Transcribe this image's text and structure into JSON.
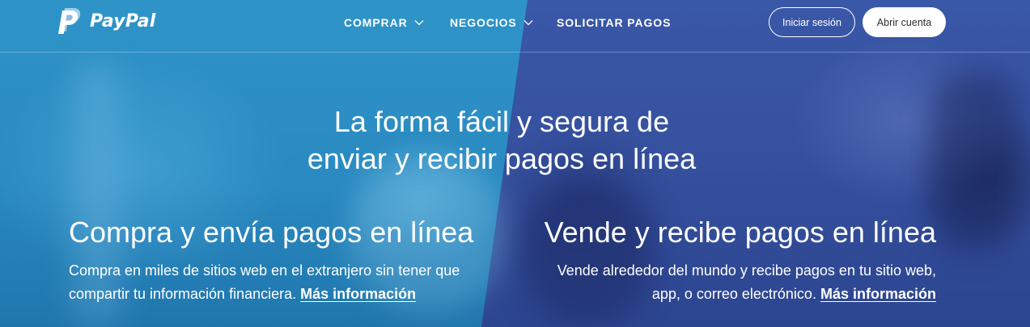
{
  "brand": {
    "name": "PayPal",
    "logo_icon": "paypal-p-icon"
  },
  "nav": {
    "items": [
      {
        "label": "COMPRAR",
        "has_dropdown": true,
        "icon": "chevron-down-icon"
      },
      {
        "label": "NEGOCIOS",
        "has_dropdown": true,
        "icon": "chevron-down-icon"
      },
      {
        "label": "SOLICITAR PAGOS",
        "has_dropdown": false
      }
    ]
  },
  "header_actions": {
    "login_label": "Iniciar sesión",
    "signup_label": "Abrir cuenta"
  },
  "hero": {
    "headline_line1": "La forma fácil y segura de",
    "headline_line2": "enviar y recibir pagos en línea"
  },
  "columns": [
    {
      "title": "Compra y envía pagos en línea",
      "text_line1": "Compra en miles de sitios web en el extranjero sin tener que",
      "text_line2": "compartir tu información financiera.",
      "link_label": "Más información"
    },
    {
      "title": "Vende y recibe pagos en línea",
      "text_line1": "Vende alrededor del mundo y recibe pagos en tu sitio web,",
      "text_line2": "app, o correo electrónico.",
      "link_label": "Más información"
    }
  ],
  "colors": {
    "left_panel": "#2a8ac1",
    "right_panel": "#35509e",
    "text": "#ffffff",
    "signup_button_bg": "#ffffff"
  }
}
